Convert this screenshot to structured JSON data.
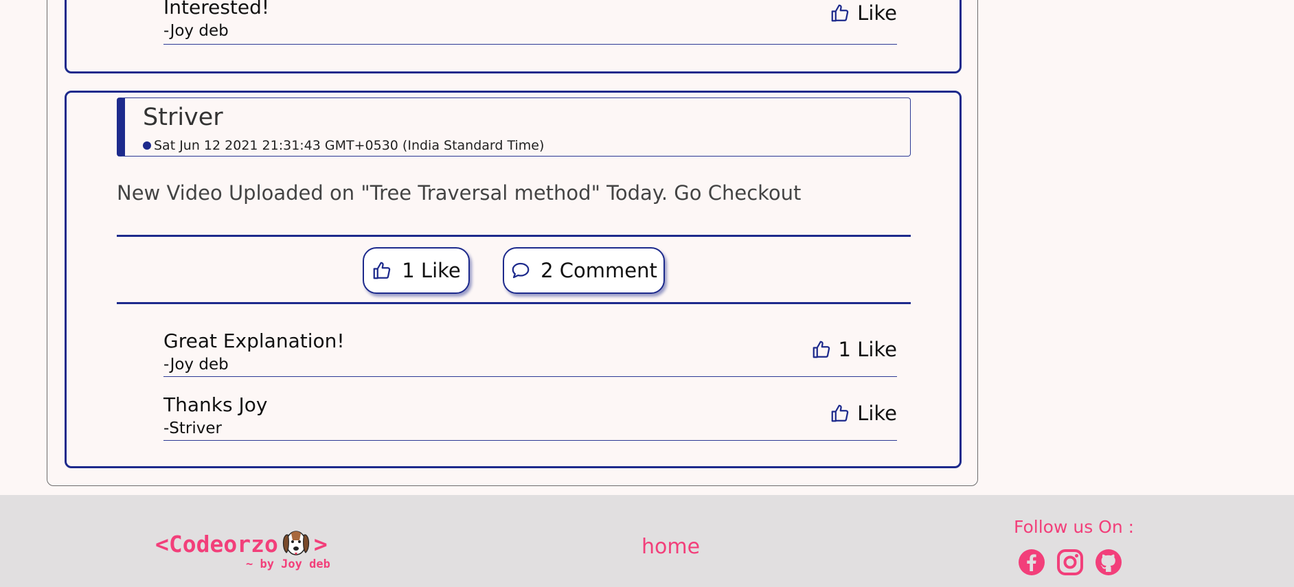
{
  "feed": {
    "top_card": {
      "comments": [
        {
          "text": "Interested!",
          "author": "-Joy deb",
          "like_label": "Like"
        }
      ]
    },
    "post": {
      "author": "Striver",
      "date": "Sat Jun 12 2021 21:31:43 GMT+0530 (India Standard Time)",
      "body": "New Video Uploaded on \"Tree Traversal method\" Today. Go Checkout",
      "like_button": "1 Like",
      "comment_button": "2 Comment",
      "comments": [
        {
          "text": "Great Explanation!",
          "author": "-Joy deb",
          "like_label": "1 Like"
        },
        {
          "text": "Thanks Joy",
          "author": "-Striver",
          "like_label": "Like"
        }
      ]
    }
  },
  "footer": {
    "brand": "<Codeorzo",
    "brand_close": ">",
    "byline": "~ by Joy deb",
    "nav_home": "home",
    "follow_label": "Follow us On :",
    "social_icons": [
      "facebook-icon",
      "instagram-icon",
      "github-icon"
    ]
  },
  "colors": {
    "accent": "#1d2a8c",
    "brand": "#f23f7a",
    "page_bg": "#fdf7f6",
    "footer_bg": "#e1dfe0"
  }
}
